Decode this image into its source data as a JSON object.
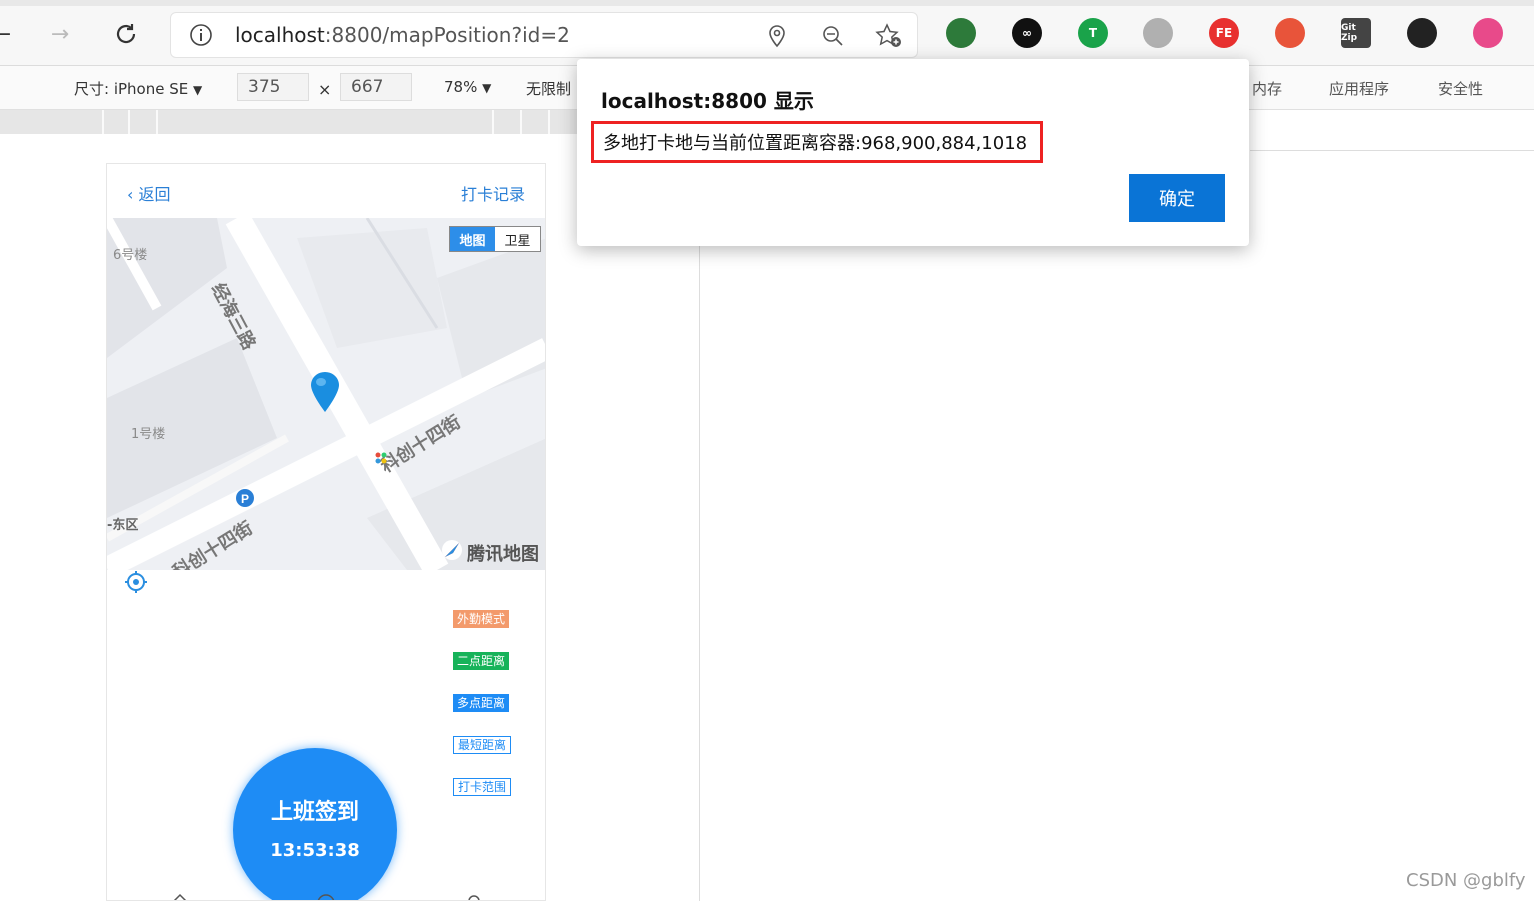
{
  "browser": {
    "url_host": "localhost",
    "url_rest": ":8800/mapPosition?id=2",
    "extensions": [
      {
        "name": "ie-tab-icon",
        "label": "",
        "color": "#2d7a3a"
      },
      {
        "name": "infinity-icon",
        "label": "∞",
        "color": "#111111"
      },
      {
        "name": "shield-t-icon",
        "label": "T",
        "color": "#1aa34a"
      },
      {
        "name": "reader-icon",
        "label": "",
        "color": "#b0b0b0"
      },
      {
        "name": "fe-icon",
        "label": "FE",
        "color": "#e8302f"
      },
      {
        "name": "network-icon",
        "label": "",
        "color": "#e8543a"
      },
      {
        "name": "git-zip-icon",
        "label": "Git Zip",
        "color": "#444444"
      },
      {
        "name": "swirl-icon",
        "label": "",
        "color": "#222222"
      },
      {
        "name": "pinwheel-icon",
        "label": "",
        "color": "#e84a8a"
      }
    ]
  },
  "devtools": {
    "size_label": "尺寸: iPhone SE",
    "width": "375",
    "height": "667",
    "times": "×",
    "zoom": "78%",
    "throttle": "无限制",
    "tabs": [
      "内存",
      "应用程序",
      "安全性"
    ]
  },
  "phone": {
    "back_label": "返回",
    "records_label": "打卡记录",
    "map": {
      "type_active": "地图",
      "type_inactive": "卫星",
      "labels": [
        "6号楼",
        "1号楼",
        "-东区"
      ],
      "roads": [
        "经海三路",
        "科创十四街",
        "科创十四街"
      ],
      "logo": "腾讯地图"
    },
    "tags": [
      {
        "label": "外勤模式",
        "style": "filled",
        "color": "#f39a6b"
      },
      {
        "label": "二点距离",
        "style": "filled",
        "color": "#17b35a"
      },
      {
        "label": "多点距离",
        "style": "filled",
        "color": "#1e8cf5"
      },
      {
        "label": "最短距离",
        "style": "outline",
        "color": "#1e8cf5"
      },
      {
        "label": "打卡范围",
        "style": "outline",
        "color": "#1e8cf5"
      }
    ],
    "sign_button": {
      "title": "上班签到",
      "time": "13:53:38"
    }
  },
  "dialog": {
    "title": "localhost:8800 显示",
    "message": "多地打卡地与当前位置距离容器:968,900,884,1018",
    "ok_label": "确定"
  },
  "watermark": "CSDN @gblfy"
}
